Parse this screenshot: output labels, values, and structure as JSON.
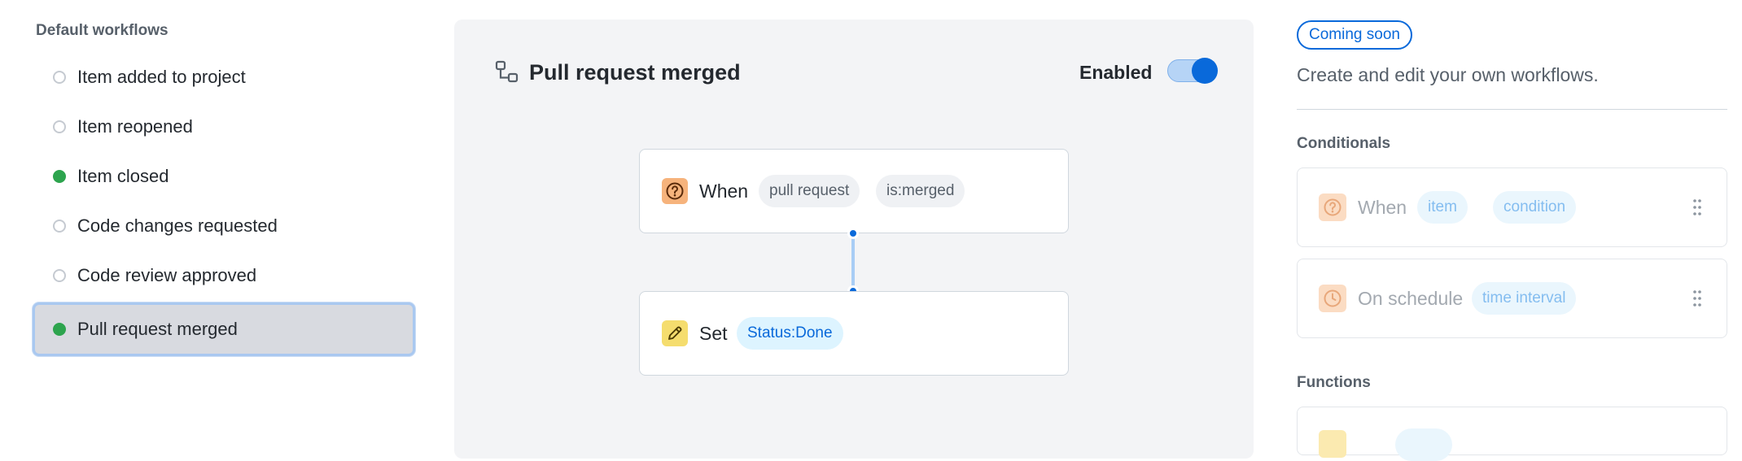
{
  "sidebar": {
    "heading": "Default workflows",
    "items": [
      {
        "label": "Item added to project",
        "enabled": false
      },
      {
        "label": "Item reopened",
        "enabled": false
      },
      {
        "label": "Item closed",
        "enabled": true
      },
      {
        "label": "Code changes requested",
        "enabled": false
      },
      {
        "label": "Code review approved",
        "enabled": false
      },
      {
        "label": "Pull request merged",
        "enabled": true,
        "selected": true
      }
    ]
  },
  "workflow": {
    "title": "Pull request merged",
    "enabled_label": "Enabled",
    "enabled": true,
    "when_node": {
      "keyword": "When",
      "pills": [
        "pull request",
        "is:merged"
      ],
      "icon": "question-circle-icon"
    },
    "set_node": {
      "keyword": "Set",
      "pill": "Status:Done",
      "icon": "pencil-icon"
    }
  },
  "right_panel": {
    "badge": "Coming soon",
    "description": "Create and edit your own workflows.",
    "conditionals": {
      "title": "Conditionals",
      "cards": [
        {
          "keyword": "When",
          "pills": [
            "item",
            "condition"
          ],
          "icon": "question-circle-icon"
        },
        {
          "keyword": "On schedule",
          "pills": [
            "time interval"
          ],
          "icon": "clock-icon"
        }
      ]
    },
    "functions": {
      "title": "Functions"
    }
  },
  "colors": {
    "accent": "#0969da",
    "enabled_dot": "#2da44e",
    "selected_bg": "#d8dae0",
    "canvas_bg": "#f3f4f6"
  }
}
